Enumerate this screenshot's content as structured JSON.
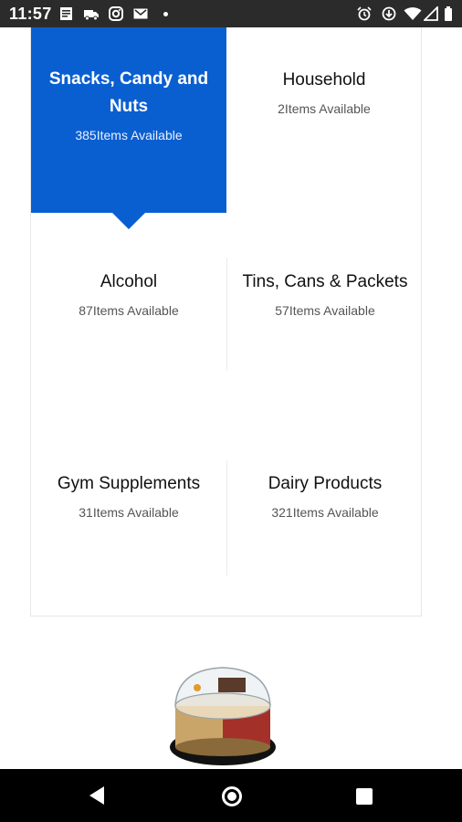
{
  "status_bar": {
    "time": "11:57",
    "left_icons": [
      "notes-icon",
      "truck-icon",
      "instagram-icon",
      "gmail-icon",
      "dot-icon"
    ],
    "right_icons": [
      "alarm-icon",
      "download-icon",
      "wifi-icon",
      "signal-icon",
      "battery-icon"
    ]
  },
  "categories": [
    {
      "title": "Snacks, Candy and Nuts",
      "count": "385Items Available",
      "selected": true
    },
    {
      "title": "Household",
      "count": "2Items Available",
      "selected": false
    },
    {
      "title": "Alcohol",
      "count": "87Items Available",
      "selected": false
    },
    {
      "title": "Tins, Cans & Packets",
      "count": "57Items Available",
      "selected": false
    },
    {
      "title": "Gym Supplements",
      "count": "31Items Available",
      "selected": false
    },
    {
      "title": "Dairy Products",
      "count": "321Items Available",
      "selected": false
    }
  ],
  "colors": {
    "selected_bg": "#0a5fd0",
    "status_bar_bg": "#2b2b2b",
    "nav_bar_bg": "#000000"
  },
  "nav_bar": {
    "icons": [
      "back-icon",
      "home-icon",
      "recents-icon"
    ]
  }
}
